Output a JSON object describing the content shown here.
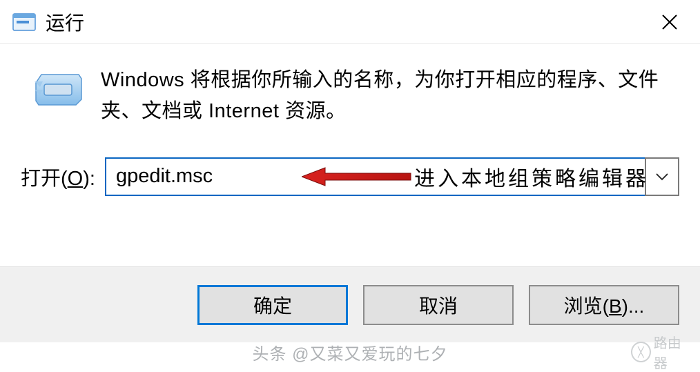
{
  "titlebar": {
    "title": "运行"
  },
  "body": {
    "description": "Windows 将根据你所输入的名称，为你打开相应的程序、文件夹、文档或 Internet 资源。",
    "open_label_prefix": "打开(",
    "open_label_key": "O",
    "open_label_suffix": "):",
    "input_value": "gpedit.msc"
  },
  "annotation": {
    "text": "进入本地组策略编辑器",
    "arrow_color": "#d8221f"
  },
  "buttons": {
    "ok": "确定",
    "cancel": "取消",
    "browse_prefix": "浏览(",
    "browse_key": "B",
    "browse_suffix": ")..."
  },
  "footer": {
    "attribution": "头条 @又菜又爱玩的七夕",
    "watermark": "路由器"
  }
}
